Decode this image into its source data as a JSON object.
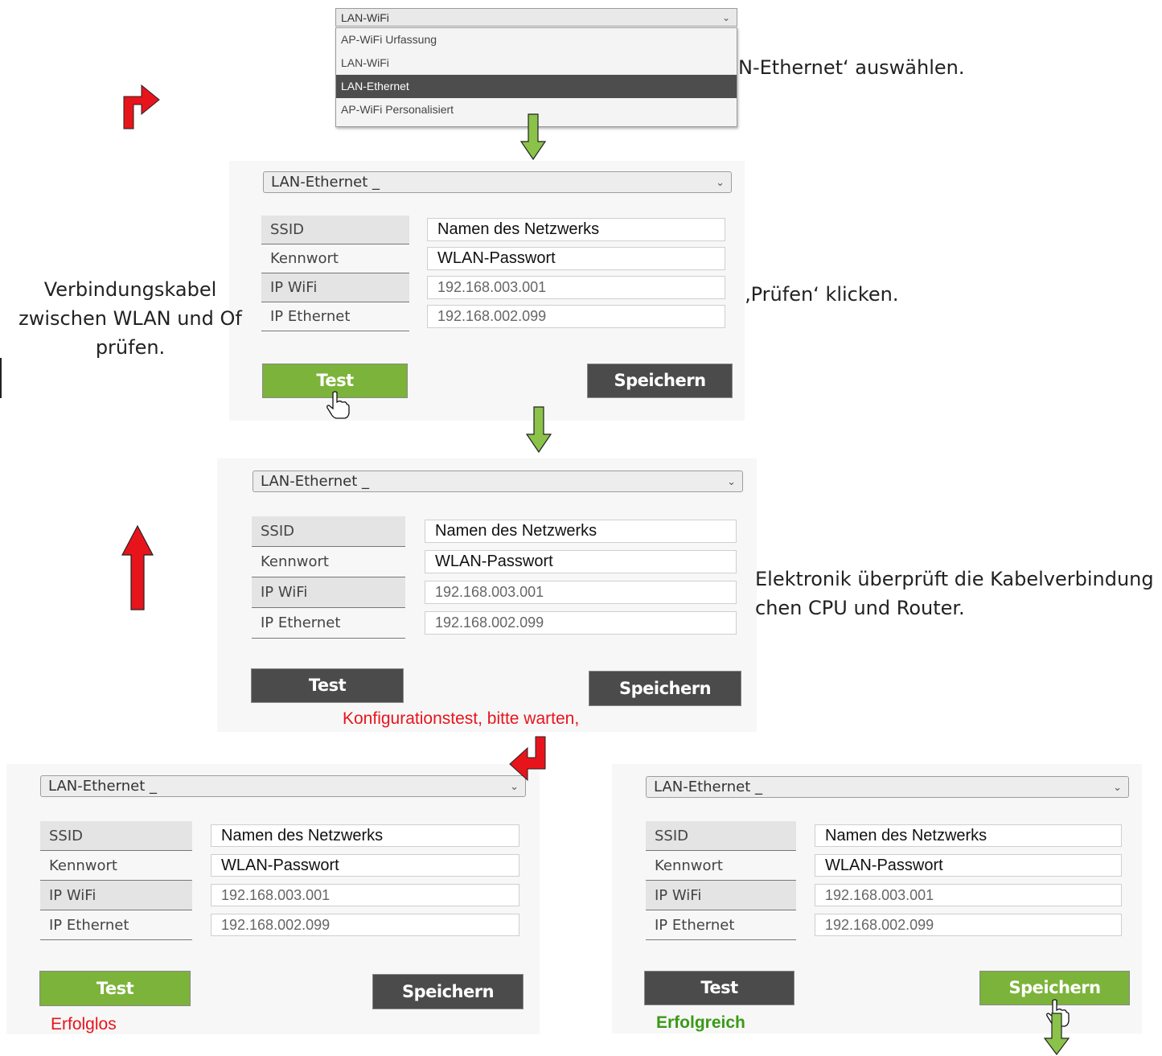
{
  "top_dropdown": {
    "current": "LAN-WiFi",
    "options": [
      "AP-WiFi Urfassung",
      "LAN-WiFi",
      "LAN-Ethernet",
      "AP-WiFi Personalisiert"
    ],
    "highlighted": "LAN-Ethernet"
  },
  "notes": {
    "step1": "N-Ethernet‘ auswählen.",
    "step2": "‚Prüfen‘ klicken.",
    "left_line1": "Verbindungskabel",
    "left_line2": "zwischen WLAN und Of",
    "left_line3": "prüfen.",
    "right_line1": "Elektronik überprüft die Kabelverbindung",
    "right_line2": "chen CPU und Router."
  },
  "panel1": {
    "mode": "LAN-Ethernet  _",
    "labels": [
      "SSID",
      "Kennwort",
      "IP WiFi",
      "IP Ethernet"
    ],
    "values": [
      "Namen des Netzwerks",
      "WLAN-Passwort",
      "192.168.003.001",
      "192.168.002.099"
    ],
    "test": "Test",
    "save": "Speichern"
  },
  "panel2": {
    "mode": "LAN-Ethernet  _",
    "labels": [
      "SSID",
      "Kennwort",
      "IP WiFi",
      "IP Ethernet"
    ],
    "values": [
      "Namen des Netzwerks",
      "WLAN-Passwort",
      "192.168.003.001",
      "192.168.002.099"
    ],
    "test": "Test",
    "save": "Speichern",
    "status": "Konfigurationstest, bitte warten,"
  },
  "panel3": {
    "mode": "LAN-Ethernet  _",
    "labels": [
      "SSID",
      "Kennwort",
      "IP WiFi",
      "IP Ethernet"
    ],
    "values": [
      "Namen des Netzwerks",
      "WLAN-Passwort",
      "192.168.003.001",
      "192.168.002.099"
    ],
    "test": "Test",
    "save": "Speichern",
    "status": "Erfolglos"
  },
  "panel4": {
    "mode": "LAN-Ethernet  _",
    "labels": [
      "SSID",
      "Kennwort",
      "IP WiFi",
      "IP Ethernet"
    ],
    "values": [
      "Namen des Netzwerks",
      "WLAN-Passwort",
      "192.168.003.001",
      "192.168.002.099"
    ],
    "test": "Test",
    "save": "Speichern",
    "status": "Erfolgreich"
  },
  "colors": {
    "red_arrow": "#e8141c",
    "green_arrow": "#8bc34a",
    "button_dark": "#4b4b4b",
    "button_green": "#7cb33a",
    "fail_text": "#e8141c",
    "success_text": "#3a9a16"
  }
}
